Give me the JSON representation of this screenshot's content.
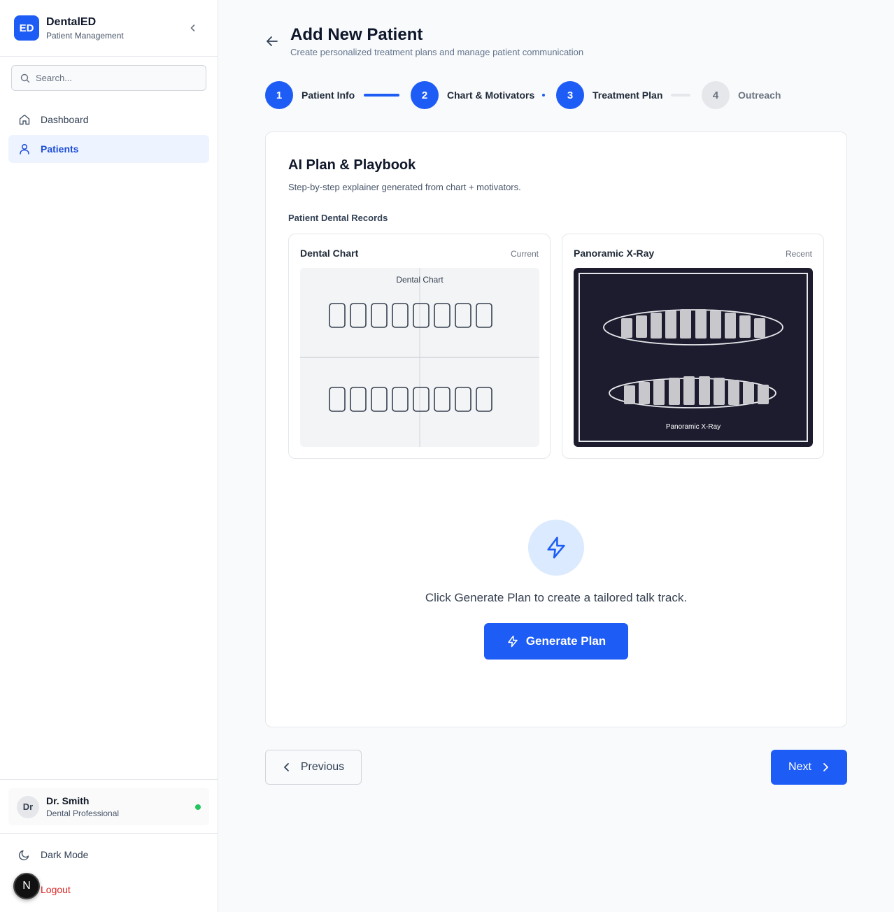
{
  "brand": {
    "logo": "ED",
    "name": "DentalED",
    "subtitle": "Patient Management"
  },
  "search": {
    "placeholder": "Search..."
  },
  "sidebar": {
    "items": [
      {
        "label": "Dashboard",
        "icon": "home-icon",
        "active": false
      },
      {
        "label": "Patients",
        "icon": "user-icon",
        "active": true
      }
    ],
    "user": {
      "initials": "Dr",
      "name": "Dr. Smith",
      "role": "Dental Professional",
      "status_color": "#22c55e"
    },
    "dark_mode_label": "Dark Mode",
    "logout_label": "Logout",
    "badge": "N"
  },
  "header": {
    "title": "Add New Patient",
    "subtitle": "Create personalized treatment plans and manage patient communication"
  },
  "stepper": {
    "steps": [
      {
        "number": "1",
        "label": "Patient Info",
        "state": "complete"
      },
      {
        "number": "2",
        "label": "Chart & Motivators",
        "state": "complete"
      },
      {
        "number": "3",
        "label": "Treatment Plan",
        "state": "current"
      },
      {
        "number": "4",
        "label": "Outreach",
        "state": "pending"
      }
    ]
  },
  "card": {
    "title": "AI Plan & Playbook",
    "subtitle": "Step-by-step explainer generated from chart + motivators.",
    "records_label": "Patient Dental Records",
    "records": [
      {
        "title": "Dental Chart",
        "tag": "Current",
        "image_caption": "Dental Chart"
      },
      {
        "title": "Panoramic X-Ray",
        "tag": "Recent",
        "image_caption": "Panoramic X-Ray"
      }
    ],
    "empty_text": "Click Generate Plan to create a tailored talk track.",
    "generate_label": "Generate Plan"
  },
  "footer": {
    "previous_label": "Previous",
    "next_label": "Next"
  },
  "colors": {
    "accent": "#1d5cf5",
    "accent_light": "#dbeafe",
    "danger": "#dc2626",
    "xray_bg": "#1c1c2e"
  }
}
